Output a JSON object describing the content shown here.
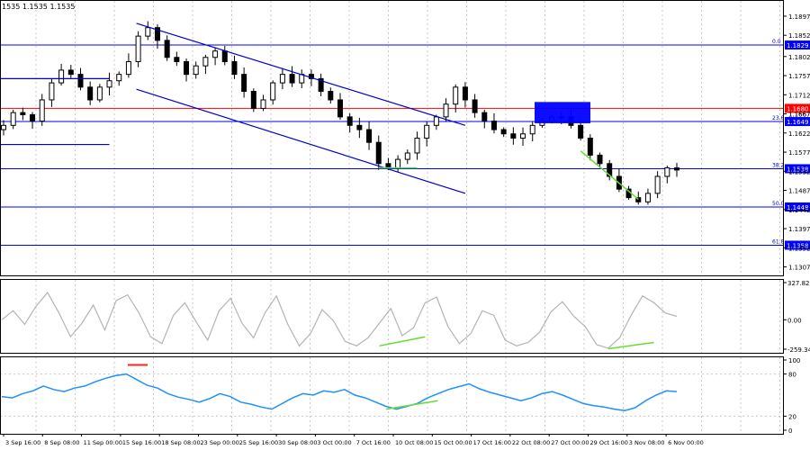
{
  "header": {
    "quote": "1535 1.1535 1.1535"
  },
  "chart_data": [
    {
      "type": "candlestick",
      "instrument_quote": "1535 1.1535 1.1535",
      "y_ticks": [
        1.1897,
        1.1852,
        1.1802,
        1.1757,
        1.1712,
        1.1667,
        1.1622,
        1.1577,
        1.1532,
        1.1487,
        1.1442,
        1.1397,
        1.1352,
        1.1307
      ],
      "ylim": [
        1.1287,
        1.1935
      ],
      "x_labels": [
        "3 Sep 16:00",
        "8 Sep 08:00",
        "11 Sep 00:00",
        "15 Sep 16:00",
        "18 Sep 08:00",
        "23 Sep 00:00",
        "25 Sep 16:00",
        "30 Sep 08:00",
        "3 Oct 00:00",
        "7 Oct 16:00",
        "10 Oct 08:00",
        "15 Oct 00:00",
        "17 Oct 16:00",
        "22 Oct 08:00",
        "27 Oct 00:00",
        "29 Oct 16:00",
        "3 Nov 08:00",
        "6 Nov 00:00"
      ],
      "close_series": [
        1.164,
        1.167,
        1.1665,
        1.165,
        1.17,
        1.174,
        1.177,
        1.176,
        1.173,
        1.17,
        1.173,
        1.1745,
        1.176,
        1.179,
        1.185,
        1.187,
        1.184,
        1.18,
        1.179,
        1.176,
        1.178,
        1.18,
        1.1815,
        1.179,
        1.176,
        1.172,
        1.168,
        1.17,
        1.174,
        1.176,
        1.174,
        1.176,
        1.175,
        1.172,
        1.17,
        1.166,
        1.164,
        1.163,
        1.16,
        1.155,
        1.154,
        1.156,
        1.1575,
        1.161,
        1.164,
        1.166,
        1.169,
        1.173,
        1.17,
        1.167,
        1.165,
        1.163,
        1.162,
        1.161,
        1.162,
        1.164,
        1.165,
        1.166,
        1.166,
        1.164,
        1.161,
        1.157,
        1.155,
        1.152,
        1.149,
        1.147,
        1.146,
        1.148,
        1.152,
        1.154,
        1.1535
      ],
      "horizontal_levels": [
        {
          "label": "1.1829",
          "fib": "0.0",
          "color": "#0000ff"
        },
        {
          "label": "1.1680",
          "fib": "",
          "color": "#ff0000"
        },
        {
          "label": "1.1649",
          "fib": "23.6",
          "color": "#0000ff"
        },
        {
          "label": "1.1538",
          "fib": "38.2",
          "color": "#0000ff"
        },
        {
          "label": "1.1448",
          "fib": "50.0",
          "color": "#0000ff"
        },
        {
          "label": "1.1358",
          "fib": "61.8",
          "color": "#0000ff"
        }
      ],
      "price_label_top": "1.1667",
      "channel": {
        "color": "#0000cc"
      },
      "zone": {
        "color": "#0000ff"
      }
    },
    {
      "type": "line",
      "name": "oscillator",
      "y_ticks": [
        "327.826",
        "0.00",
        "-259.342"
      ],
      "color": "#b4b4b4",
      "values": [
        0,
        80,
        -40,
        120,
        240,
        60,
        -150,
        -30,
        130,
        -90,
        170,
        220,
        60,
        -150,
        -210,
        40,
        150,
        -20,
        -180,
        80,
        190,
        -30,
        -160,
        60,
        210,
        -40,
        -230,
        -120,
        90,
        -10,
        -190,
        -230,
        -160,
        -30,
        100,
        -140,
        -70,
        150,
        200,
        -60,
        -210,
        -120,
        80,
        40,
        -180,
        -230,
        -200,
        -110,
        70,
        160,
        30,
        -60,
        -220,
        -250,
        -160,
        40,
        210,
        150,
        60,
        30
      ],
      "divergence_color": "#66dd33"
    },
    {
      "type": "line",
      "name": "rsi",
      "y_ticks": [
        "100",
        "80",
        "20",
        "0"
      ],
      "color": "#1e90ff",
      "values": [
        48,
        46,
        52,
        56,
        63,
        58,
        55,
        60,
        63,
        69,
        74,
        78,
        80,
        72,
        64,
        60,
        52,
        47,
        44,
        40,
        45,
        52,
        48,
        40,
        37,
        33,
        30,
        38,
        46,
        52,
        50,
        56,
        54,
        58,
        50,
        46,
        40,
        34,
        30,
        34,
        38,
        46,
        52,
        58,
        62,
        66,
        59,
        54,
        50,
        46,
        42,
        46,
        52,
        55,
        50,
        44,
        38,
        35,
        33,
        30,
        28,
        32,
        42,
        50,
        56,
        55
      ],
      "divergence_color": "#66dd33",
      "overbought_marker_color": "#ff2222"
    }
  ]
}
